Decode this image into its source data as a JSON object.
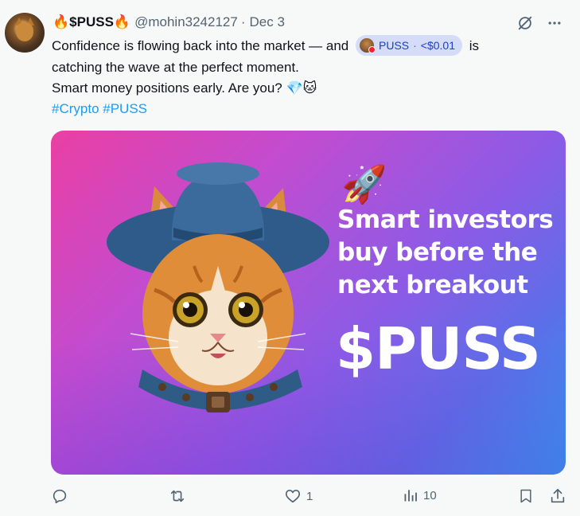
{
  "tweet": {
    "display_name": "🔥$PUSS🔥",
    "handle": "@mohin3242127",
    "separator": "·",
    "date": "Dec 3",
    "text_line1_a": "Confidence is flowing back into the market — and",
    "text_line1_b": "is",
    "text_line2": "catching the wave at the perfect moment.",
    "text_line3": "Smart money positions early. Are you? 💎🐱",
    "cashtag": {
      "symbol": "PUSS",
      "separator": "·",
      "price": "<$0.01"
    },
    "hashtags": "#Crypto #PUSS"
  },
  "media": {
    "headline_1": "Smart investors",
    "headline_2": "buy before the",
    "headline_3": "next breakout",
    "ticker": "$PUSS",
    "rocket": "🚀"
  },
  "actions": {
    "reply_count": "",
    "repost_count": "",
    "like_count": "1",
    "views_count": "10"
  },
  "icons": [
    "avatar",
    "grok-icon",
    "more-icon",
    "reply-icon",
    "repost-icon",
    "like-icon",
    "views-icon",
    "bookmark-icon",
    "share-icon"
  ],
  "colors": {
    "link": "#1d9bf0",
    "muted": "#536471",
    "pill_bg": "#d5dcf8"
  }
}
